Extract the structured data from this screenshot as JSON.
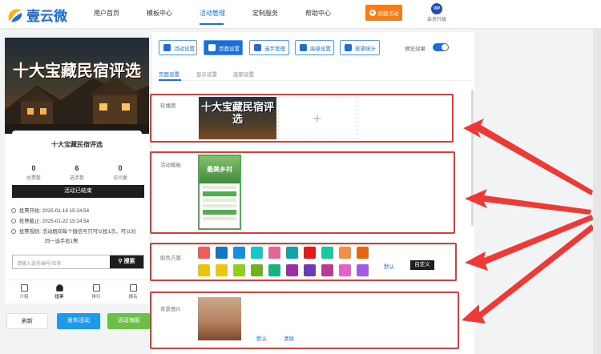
{
  "header": {
    "logo_text": "壹云微",
    "nav": [
      "用户首页",
      "模板中心",
      "活动管理",
      "定制服务",
      "帮助中心"
    ],
    "active_nav": "活动管理",
    "create_button": "创建活动",
    "vip_badge": "VIP",
    "vip_label": "会员升级"
  },
  "preview": {
    "cover_title": "十大宝藏民宿评选",
    "card_title": "十大宝藏民宿评选",
    "stats": [
      {
        "value": "0",
        "label": "总票数"
      },
      {
        "value": "6",
        "label": "选手数"
      },
      {
        "value": "0",
        "label": "访问量"
      }
    ],
    "ended_label": "活动已结束",
    "info": [
      "投票开始:  2025-01-16 15:24:54",
      "投票截止:  2025-01-22 15:24:54",
      "投票规则:  活动期间每个微信号只可以投1次，可以对",
      "同一选手投1票"
    ],
    "search_placeholder": "请输入选手编号/名称",
    "search_button": "搜索",
    "tabs": [
      "介绍",
      "投票",
      "排行",
      "报名"
    ],
    "active_tab": "投票"
  },
  "actions": {
    "refresh": "刷新",
    "publish": "发布活动",
    "poster": "活动海报"
  },
  "editor": {
    "top_tabs": [
      "活动设置",
      "页面设置",
      "选手管理",
      "高级设置",
      "投票统计"
    ],
    "active_top_tab": "页面设置",
    "preview_toggle_label": "预览效果",
    "preview_toggle_on": true,
    "sub_tabs": [
      "页面设置",
      "显示设置",
      "底部设置"
    ],
    "active_sub_tab": "页面设置",
    "carousel": {
      "label": "轮播图",
      "thumb_text": "十大宝藏民宿评选",
      "add_glyph": "+"
    },
    "template": {
      "label": "活动模板",
      "thumb_text": "最美乡村"
    },
    "colors": {
      "label": "配色方案",
      "row1": [
        "#f05b5b",
        "#1674c4",
        "#1a8fe0",
        "#17c7c7",
        "#e26996",
        "#12a3a6",
        "#e21a1a",
        "#1ac89e",
        "#f28e4c",
        "#e8660f"
      ],
      "row2": [
        "#e8c60e",
        "#f0c314",
        "#8fce1c",
        "#6fb11e",
        "#14b57a",
        "#9a2fa8",
        "#6d3bb8",
        "#b73b97",
        "#e85ec7",
        "#a557e6"
      ],
      "default_link": "默认",
      "custom_button": "自定义"
    },
    "background": {
      "label": "背景图片",
      "default_link": "默认",
      "clear_link": "清除"
    }
  }
}
